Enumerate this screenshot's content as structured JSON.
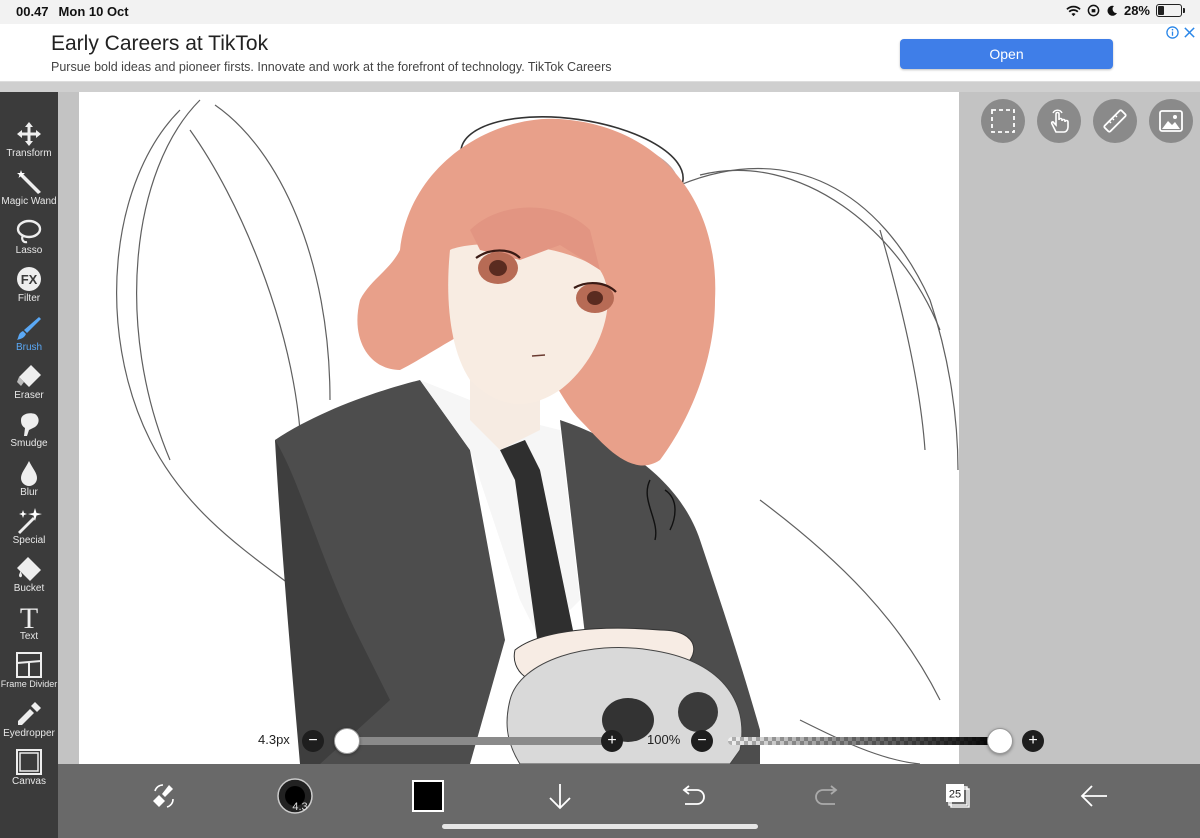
{
  "status_bar": {
    "time": "00.47",
    "date": "Mon 10 Oct",
    "battery": "28%",
    "battery_level": 0.28
  },
  "ad": {
    "title": "Early Careers at TikTok",
    "subtitle": "Pursue bold ideas and pioneer firsts. Innovate and work at the forefront of technology. TikTok Careers",
    "button": "Open",
    "info_icon": "info-icon",
    "close_icon": "close-icon"
  },
  "toolbar": {
    "items": [
      {
        "label": "Transform",
        "icon": "move-icon"
      },
      {
        "label": "Magic Wand",
        "icon": "magic-wand-icon"
      },
      {
        "label": "Lasso",
        "icon": "lasso-icon"
      },
      {
        "label": "Filter",
        "icon": "fx-icon",
        "glyph": "FX"
      },
      {
        "label": "Brush",
        "icon": "brush-icon",
        "active": true
      },
      {
        "label": "Eraser",
        "icon": "eraser-icon"
      },
      {
        "label": "Smudge",
        "icon": "smudge-icon"
      },
      {
        "label": "Blur",
        "icon": "droplet-icon"
      },
      {
        "label": "Special",
        "icon": "sparkle-icon"
      },
      {
        "label": "Bucket",
        "icon": "bucket-icon"
      },
      {
        "label": "Text",
        "icon": "text-icon",
        "glyph": "T"
      },
      {
        "label": "Frame Divider",
        "icon": "frame-divider-icon"
      },
      {
        "label": "Eyedropper",
        "icon": "eyedropper-icon"
      },
      {
        "label": "Canvas",
        "icon": "canvas-icon"
      }
    ],
    "accent": "#5aa8f5"
  },
  "quick_buttons": [
    "selection-icon",
    "touch-icon",
    "ruler-icon",
    "image-icon"
  ],
  "brush_size": {
    "label": "4.3px",
    "minus": "−",
    "plus": "+"
  },
  "opacity": {
    "label": "100%",
    "minus": "−",
    "plus": "+",
    "value": 1.0
  },
  "bottom_bar": {
    "swap_icon": "brush-eraser-swap-icon",
    "brush_preview_value": "4.3",
    "current_color": "#000000",
    "down_icon": "arrow-down-icon",
    "undo_icon": "undo-icon",
    "redo_icon": "redo-icon",
    "layers_count": "25",
    "back_icon": "arrow-left-icon"
  }
}
